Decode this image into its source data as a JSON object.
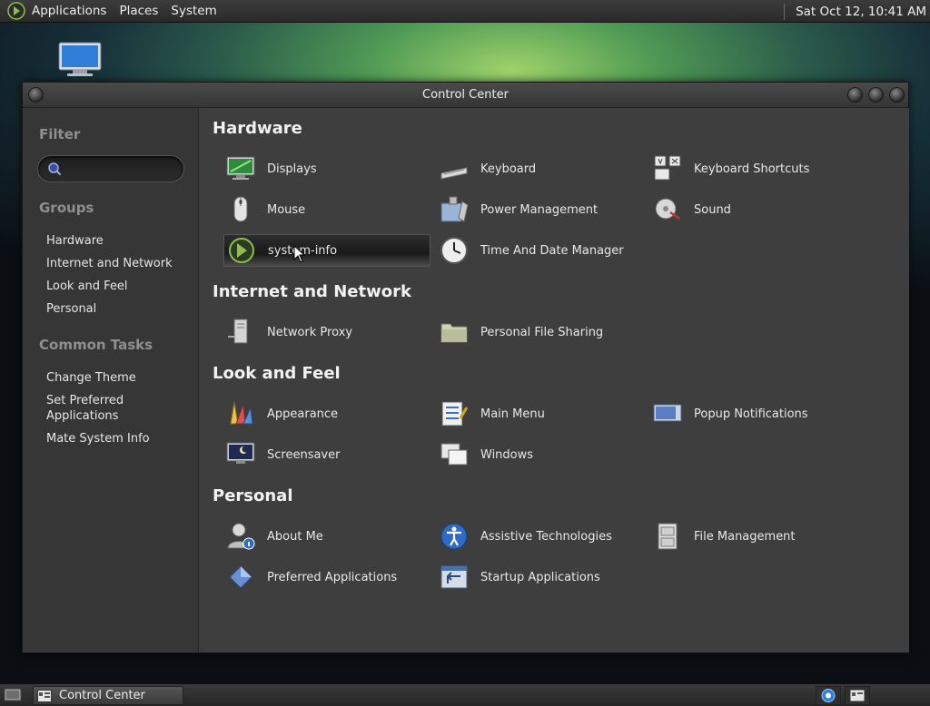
{
  "top_panel": {
    "menus": [
      "Applications",
      "Places",
      "System"
    ],
    "clock": "Sat Oct 12, 10:41 AM"
  },
  "window": {
    "title": "Control Center"
  },
  "sidebar": {
    "filter_heading": "Filter",
    "search_placeholder": "",
    "groups_heading": "Groups",
    "groups": [
      "Hardware",
      "Internet and Network",
      "Look and Feel",
      "Personal"
    ],
    "tasks_heading": "Common Tasks",
    "tasks": [
      "Change Theme",
      "Set Preferred\nApplications",
      "Mate System Info"
    ]
  },
  "content": {
    "sections": [
      {
        "title": "Hardware",
        "items": [
          {
            "label": "Displays",
            "icon": "display-icon"
          },
          {
            "label": "Keyboard",
            "icon": "keyboard-icon"
          },
          {
            "label": "Keyboard Shortcuts",
            "icon": "keyboard-shortcuts-icon"
          },
          {
            "label": "Mouse",
            "icon": "mouse-icon"
          },
          {
            "label": "Power Management",
            "icon": "power-management-icon"
          },
          {
            "label": "Sound",
            "icon": "sound-icon"
          },
          {
            "label": "system-info",
            "icon": "system-info-icon",
            "selected": true
          },
          {
            "label": "Time And Date Manager",
            "icon": "clock-icon"
          }
        ]
      },
      {
        "title": "Internet and Network",
        "items": [
          {
            "label": "Network Proxy",
            "icon": "network-proxy-icon"
          },
          {
            "label": "Personal File Sharing",
            "icon": "folder-share-icon"
          }
        ]
      },
      {
        "title": "Look and Feel",
        "items": [
          {
            "label": "Appearance",
            "icon": "appearance-icon"
          },
          {
            "label": "Main Menu",
            "icon": "main-menu-icon"
          },
          {
            "label": "Popup Notifications",
            "icon": "popup-notification-icon"
          },
          {
            "label": "Screensaver",
            "icon": "screensaver-icon"
          },
          {
            "label": "Windows",
            "icon": "windows-icon"
          }
        ]
      },
      {
        "title": "Personal",
        "items": [
          {
            "label": "About Me",
            "icon": "about-me-icon"
          },
          {
            "label": "Assistive Technologies",
            "icon": "accessibility-icon"
          },
          {
            "label": "File Management",
            "icon": "file-management-icon"
          },
          {
            "label": "Preferred Applications",
            "icon": "preferred-apps-icon"
          },
          {
            "label": "Startup Applications",
            "icon": "startup-apps-icon"
          }
        ]
      }
    ]
  },
  "bottom_panel": {
    "task_label": "Control Center"
  }
}
